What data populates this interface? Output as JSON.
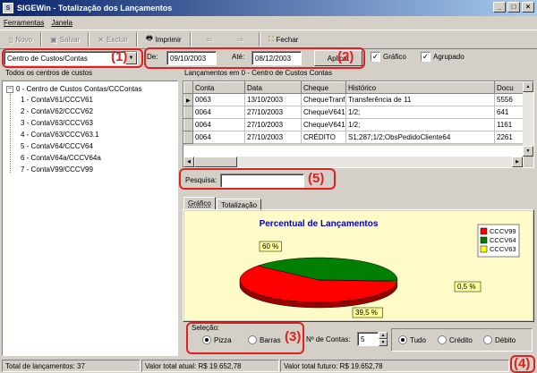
{
  "window": {
    "title": "SIGEWin - Totalização dos Lançamentos"
  },
  "menu": [
    "Ferramentas",
    "Janela"
  ],
  "toolbar": {
    "novo": "Novo",
    "salvar": "Salvar",
    "excluir": "Excluir",
    "imprimir": "Imprimir",
    "fechar": "Fechar"
  },
  "filter": {
    "combo_value": "Centro de Custos/Contas",
    "de_label": "De:",
    "de_value": "09/10/2003",
    "ate_label": "Até:",
    "ate_value": "08/12/2003",
    "aplicar": "Aplicar",
    "grafico_label": "Gráfico",
    "agrupado_label": "Agrupado"
  },
  "tree": {
    "header": "Todos os centros de custos",
    "root": "0 - Centro de Custos Contas/CCContas",
    "items": [
      "1 - ContaV61/CCCV61",
      "2 - ContaV62/CCCV62",
      "3 - ContaV63/CCCV63",
      "4 - ContaV63/CCCV63.1",
      "5 - ContaV64/CCCV64",
      "6 - ContaV64a/CCCV64a",
      "7 - ContaV99/CCCV99"
    ]
  },
  "grid": {
    "header": "Lançamentos em 0 - Centro de Custos Contas",
    "columns": [
      "Conta",
      "Data",
      "Cheque",
      "Histórico",
      "Docu"
    ],
    "rows": [
      [
        "0063",
        "13/10/2003",
        "ChequeTranf",
        "Transferência de 11",
        "5556"
      ],
      [
        "0064",
        "27/10/2003",
        "ChequeV641",
        "1/2;",
        "641"
      ],
      [
        "0064",
        "27/10/2003",
        "ChequeV641",
        "1/2;",
        "1161"
      ],
      [
        "0064",
        "27/10/2003",
        "CRÉDITO",
        "S1;287;1/2;ObsPedidoCliente64",
        "2261"
      ]
    ]
  },
  "search": {
    "label": "Pesquisa:",
    "value": ""
  },
  "tabs": [
    "Gráfico",
    "Totalização"
  ],
  "chart_data": {
    "type": "pie",
    "title": "Percentual de Lançamentos",
    "slices": [
      {
        "name": "CCCV99",
        "value": 60,
        "label": "60 %",
        "color": "#ff0000"
      },
      {
        "name": "CCCV64",
        "value": 39.5,
        "label": "39,5 %",
        "color": "#007f00"
      },
      {
        "name": "CCCV63",
        "value": 0.5,
        "label": "0,5 %",
        "color": "#ffff00"
      }
    ],
    "legend": "top-right",
    "background": "#fffbc8"
  },
  "options": {
    "selecao_label": "Seleção:",
    "pizza": "Pizza",
    "barras": "Barras",
    "num_contas_label": "Nº de Contas:",
    "num_contas_value": "5",
    "tudo": "Tudo",
    "credito": "Crédito",
    "debito": "Débito"
  },
  "status": {
    "total": "Total de lançamentos: 37",
    "atual": "Valor total atual: R$ 19.652,78",
    "futuro": "Valor total futuro: R$ 19.652,78"
  },
  "annotations": [
    "(1)",
    "(2)",
    "(3)",
    "(4)",
    "(5)"
  ],
  "colors": {
    "annotation": "#e02020",
    "title_start": "#0a246a",
    "chart_title": "#0000c0"
  }
}
